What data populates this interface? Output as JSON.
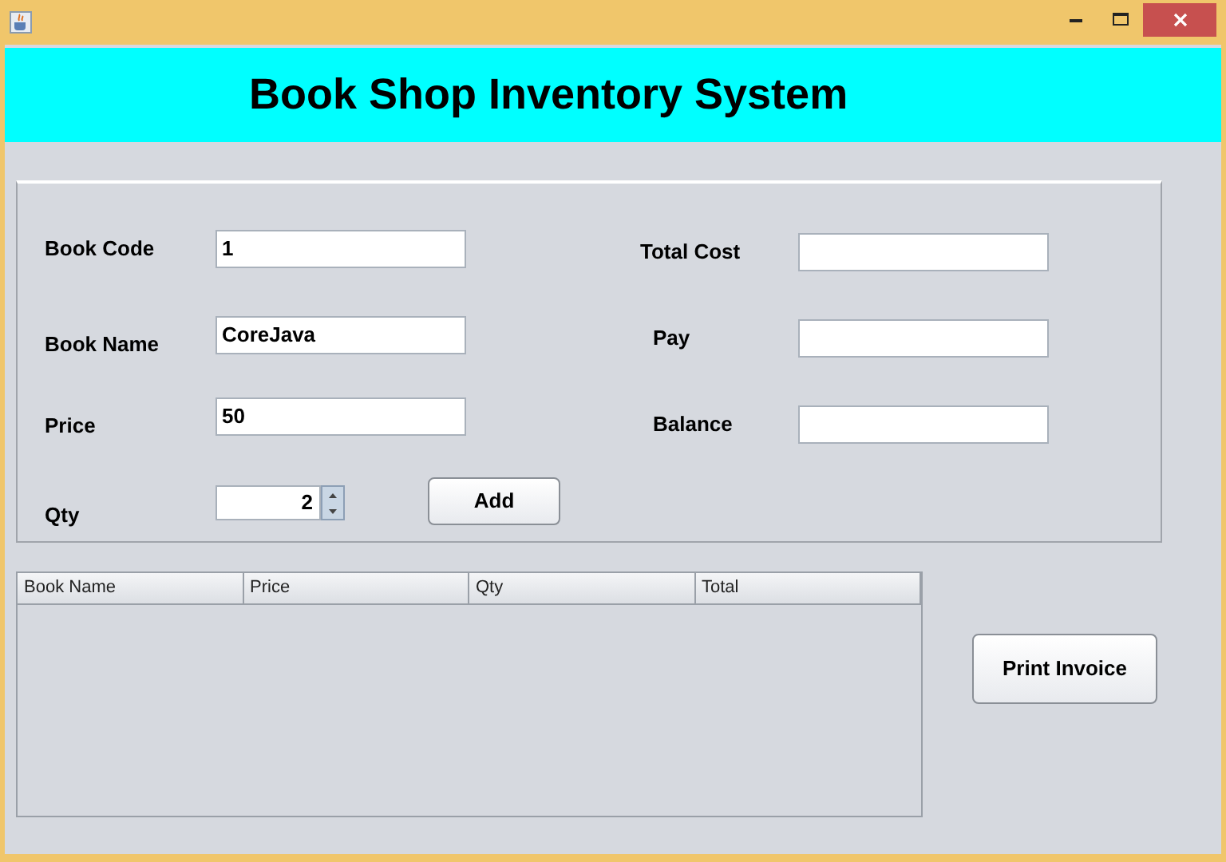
{
  "header": {
    "title": "Book Shop Inventory System"
  },
  "form": {
    "left": [
      {
        "kind": "text",
        "label": "Book Code",
        "value": "1"
      },
      {
        "kind": "text",
        "label": "Book Name",
        "value": "CoreJava"
      },
      {
        "kind": "text",
        "label": "Price",
        "value": "50"
      },
      {
        "kind": "spinner",
        "label": "Qty",
        "value": "2"
      }
    ],
    "add_button": "Add",
    "right": [
      {
        "label": "Total Cost"
      },
      {
        "label": "Pay"
      },
      {
        "label": "Balance"
      }
    ]
  },
  "table": {
    "columns": [
      "Book Name",
      "Price",
      "Qty",
      "Total"
    ]
  },
  "print_button": "Print Invoice"
}
